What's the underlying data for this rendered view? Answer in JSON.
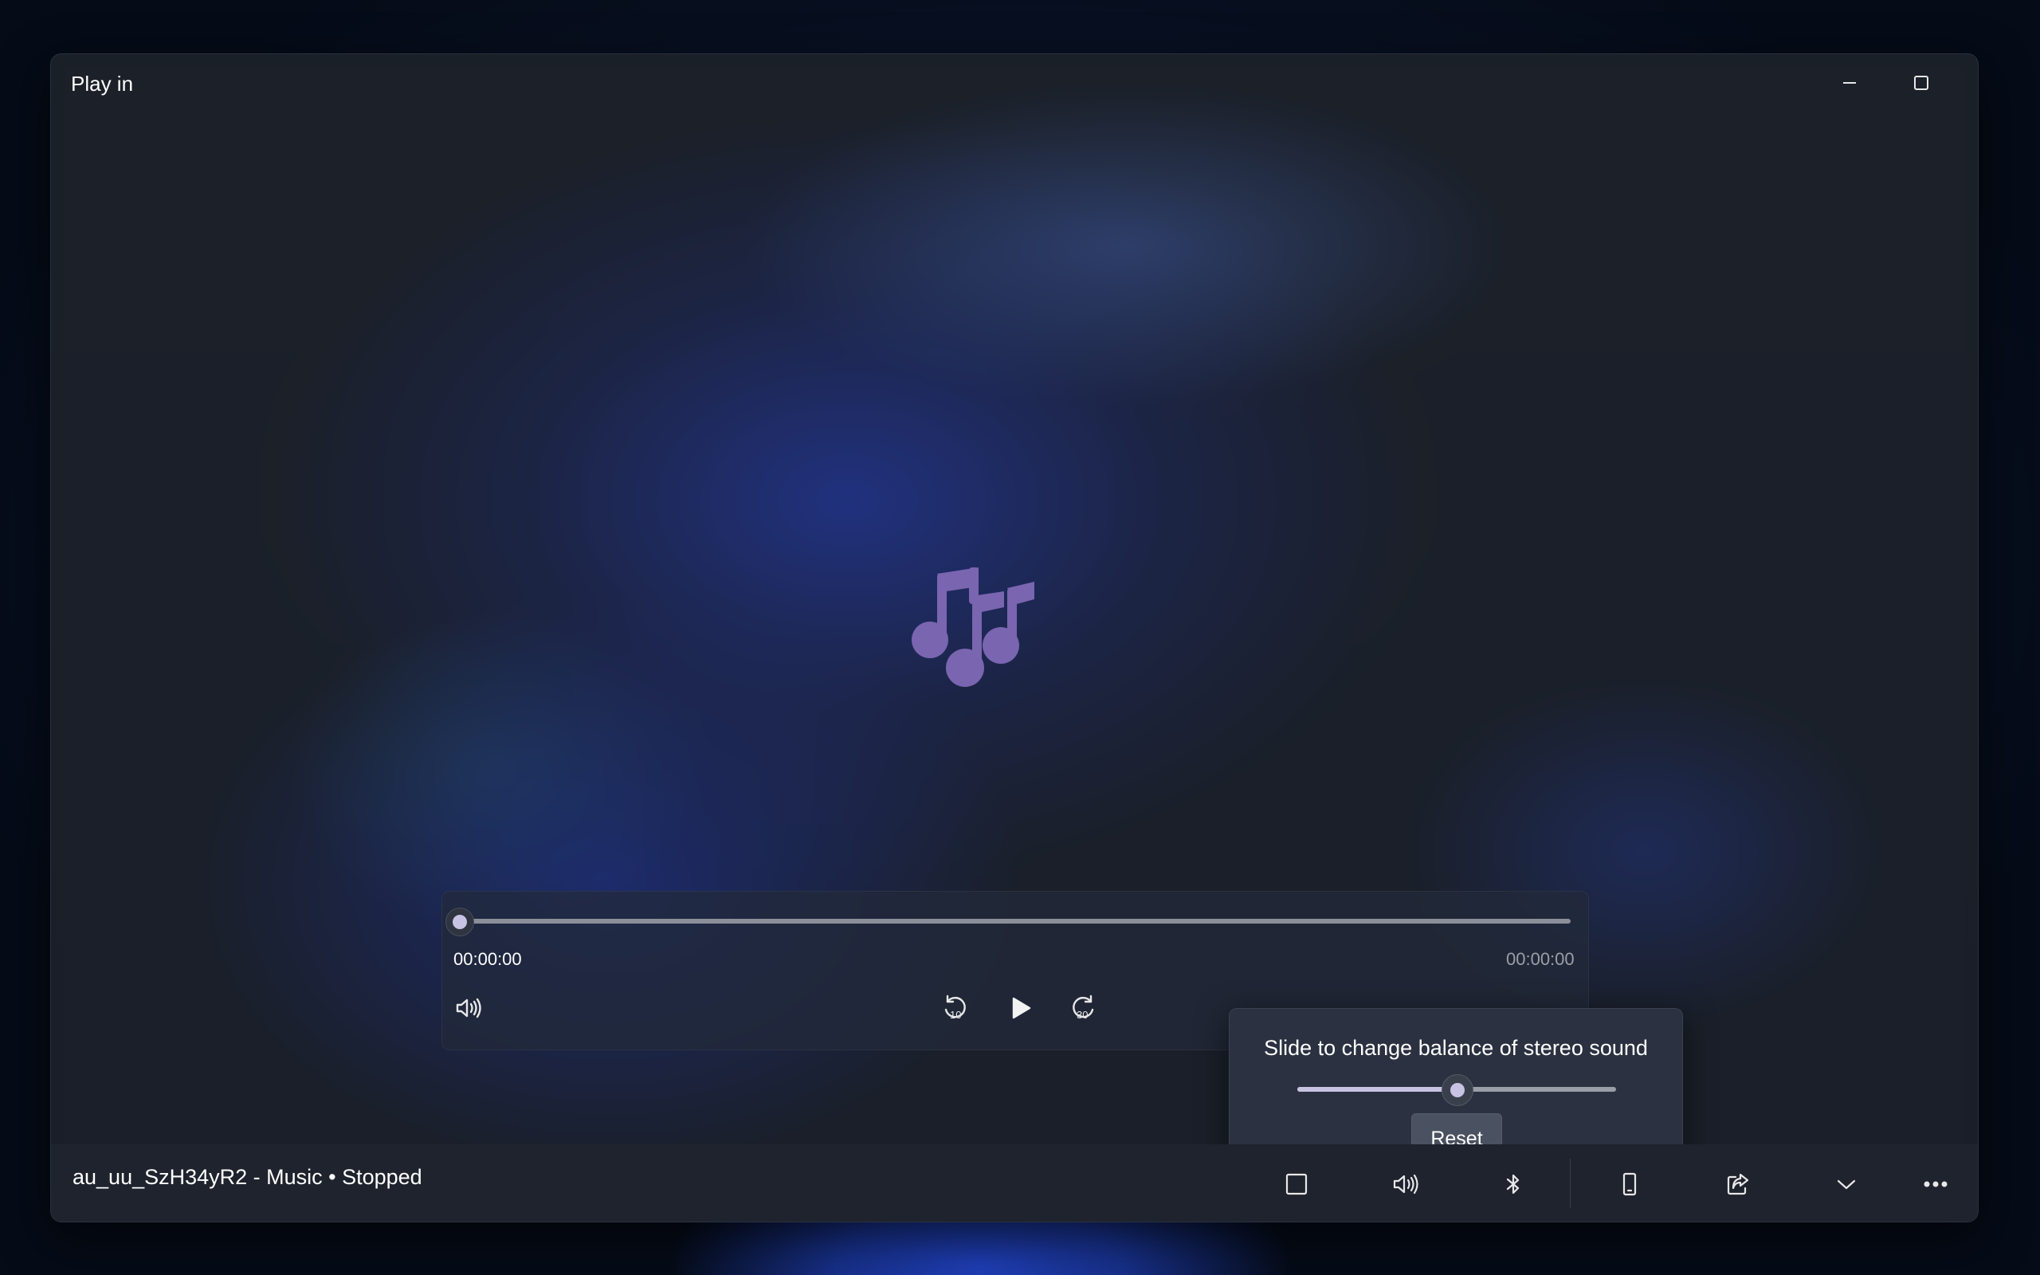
{
  "window": {
    "title": "Play in"
  },
  "window_controls": [
    "minimize-icon",
    "maximize-icon",
    "close-icon"
  ],
  "player": {
    "artwork_icon": "music-notes-icon",
    "artwork_color": "#7a65b0",
    "time_current": "00:00:00",
    "time_total": "00:00:00",
    "progress": 0,
    "controls": {
      "volume_icon": "volume-icon",
      "rewind_icon": "rewind-10-icon",
      "rewind_label": "10",
      "play_icon": "play-icon",
      "forward_icon": "forward-30-icon",
      "forward_label": "30"
    }
  },
  "balance_popup": {
    "title": "Slide to change balance of stereo sound",
    "value": 0.5,
    "reset_label": "Reset"
  },
  "statusbar": {
    "text": "au_uu_SzH34yR2 - Music • Stopped",
    "buttons": [
      "miniplayer-icon",
      "volume-icon",
      "bluetooth-icon",
      "phone-icon",
      "share-icon",
      "chevron-down-icon",
      "more-icon"
    ]
  },
  "colors": {
    "accent": "#c9c3e3",
    "window_bg": "#1a1f28"
  }
}
